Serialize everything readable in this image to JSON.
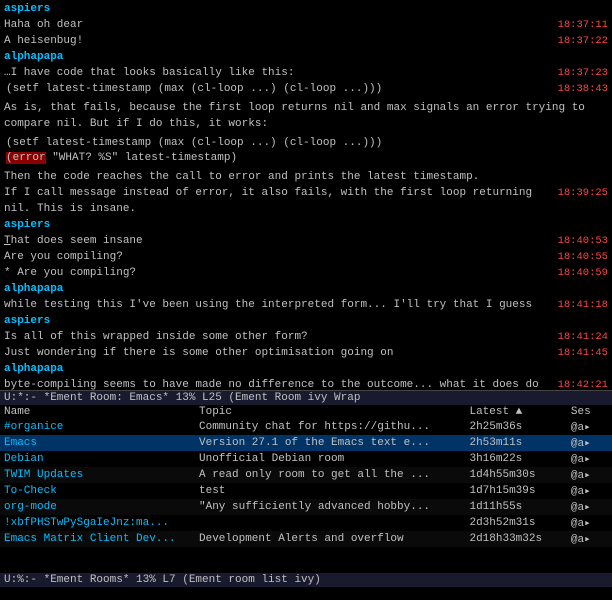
{
  "chat": {
    "messages": [
      {
        "id": "m1",
        "user": "aspiers",
        "lines": [
          {
            "text": "Haha oh dear",
            "timestamp": "18:37:11"
          },
          {
            "text": "A heisenbug!",
            "timestamp": "18:37:22"
          }
        ]
      },
      {
        "id": "m2",
        "user": "alphapapa",
        "lines": [
          {
            "text": "…I have code that looks basically like this:",
            "timestamp": "18:37:23"
          },
          {
            "text": "(setf latest-timestamp (max (cl-loop ...) (cl-loop ...)))",
            "timestamp": "18:38:43",
            "code": true
          }
        ]
      },
      {
        "id": "m3",
        "user": "",
        "lines": [
          {
            "text": "As is, that fails, because the first loop returns nil and max signals an error trying to compare nil. But if I do this, it works:",
            "timestamp": ""
          }
        ]
      },
      {
        "id": "m4",
        "user": "",
        "lines": [
          {
            "text": "(setf latest-timestamp (max (cl-loop ...) (cl-loop ...)))",
            "timestamp": "",
            "code": true
          },
          {
            "text": "(error \"WHAT? %S\" latest-timestamp)",
            "timestamp": "",
            "code": true,
            "error": true
          }
        ]
      },
      {
        "id": "m5",
        "user": "",
        "lines": [
          {
            "text": "Then the code reaches the call to error and prints the latest timestamp.",
            "timestamp": ""
          },
          {
            "text": "If I call message instead of error, it also fails, with the first loop returning nil. This is insane.",
            "timestamp": "18:39:25"
          }
        ]
      },
      {
        "id": "m6",
        "user": "aspiers",
        "lines": [
          {
            "text": "That does seem insane",
            "timestamp": "18:40:53"
          },
          {
            "text": "Are you compiling?",
            "timestamp": "18:40:55"
          },
          {
            "text": " * Are you compiling?",
            "timestamp": "18:40:59"
          }
        ]
      },
      {
        "id": "m7",
        "user": "alphapapa",
        "lines": [
          {
            "text": "while testing this I've been using the interpreted form... I'll try that I guess",
            "timestamp": "18:41:18"
          }
        ]
      },
      {
        "id": "m8",
        "user": "aspiers",
        "lines": [
          {
            "text": "Is all of this wrapped inside some other form?",
            "timestamp": "18:41:24"
          },
          {
            "text": "Just wondering if there is some other optimisation going on",
            "timestamp": "18:41:45"
          }
        ]
      },
      {
        "id": "m9",
        "user": "alphapapa",
        "lines": [
          {
            "text": "byte-compiling seems to have made no difference to the outcome... what it does do is hide the offending line from the backtrace... that's why I had to use C-M-x on the defun",
            "timestamp": "18:42:21"
          }
        ]
      }
    ]
  },
  "status_bar_top": {
    "text": "U:*:-   *Ement Room: Emacs*   13% L25   (Ement Room ivy Wrap"
  },
  "room_list": {
    "columns": {
      "name": "Name",
      "topic": "Topic",
      "latest": "Latest ▲",
      "ses": "Ses"
    },
    "rooms": [
      {
        "name": "#organice",
        "topic": "Community chat for https://githu...",
        "latest": "2h25m36s",
        "ses": "@a▸"
      },
      {
        "name": "Emacs",
        "topic": "Version 27.1 of the Emacs text e...",
        "latest": "2h53m11s",
        "ses": "@a▸",
        "highlight": true
      },
      {
        "name": "Debian",
        "topic": "Unofficial Debian room",
        "latest": "3h16m22s",
        "ses": "@a▸"
      },
      {
        "name": "TWIM Updates",
        "topic": "A read only room to get all the ...",
        "latest": "1d4h55m30s",
        "ses": "@a▸"
      },
      {
        "name": "To-Check",
        "topic": "test",
        "latest": "1d7h15m39s",
        "ses": "@a▸"
      },
      {
        "name": "org-mode",
        "topic": "\"Any sufficiently advanced hobby...",
        "latest": "1d11h55s",
        "ses": "@a▸"
      },
      {
        "name": "!xbfPHSTwPySgaIeJnz:ma...",
        "topic": "",
        "latest": "2d3h52m31s",
        "ses": "@a▸"
      },
      {
        "name": "Emacs Matrix Client Dev...",
        "topic": "Development Alerts and overflow",
        "latest": "2d18h33m32s",
        "ses": "@a▸"
      }
    ]
  },
  "status_bar_bottom": {
    "text": "U:%:-   *Ement Rooms*   13% L7   (Ement room list ivy)"
  }
}
